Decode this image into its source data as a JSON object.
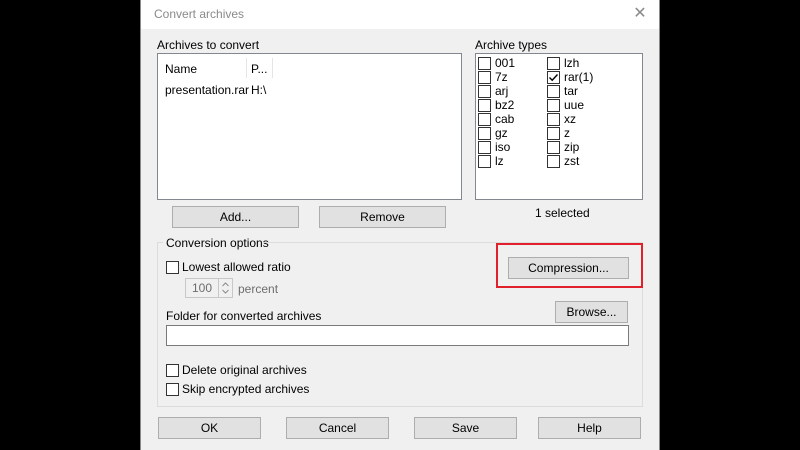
{
  "dialog": {
    "title": "Convert archives"
  },
  "archives": {
    "label": "Archives to convert",
    "columns": [
      "Name",
      "P..."
    ],
    "rows": [
      {
        "name": "presentation.rar",
        "path": "H:\\"
      }
    ]
  },
  "types": {
    "label": "Archive types",
    "col1": [
      {
        "name": "001",
        "checked": false
      },
      {
        "name": "7z",
        "checked": false
      },
      {
        "name": "arj",
        "checked": false
      },
      {
        "name": "bz2",
        "checked": false
      },
      {
        "name": "cab",
        "checked": false
      },
      {
        "name": "gz",
        "checked": false
      },
      {
        "name": "iso",
        "checked": false
      },
      {
        "name": "lz",
        "checked": false
      }
    ],
    "col2": [
      {
        "name": "lzh",
        "checked": false
      },
      {
        "name": "rar(1)",
        "checked": true
      },
      {
        "name": "tar",
        "checked": false
      },
      {
        "name": "uue",
        "checked": false
      },
      {
        "name": "xz",
        "checked": false
      },
      {
        "name": "z",
        "checked": false
      },
      {
        "name": "zip",
        "checked": false
      },
      {
        "name": "zst",
        "checked": false
      }
    ],
    "selected_text": "1 selected"
  },
  "buttons": {
    "add": "Add...",
    "remove": "Remove",
    "compression": "Compression...",
    "browse": "Browse...",
    "ok": "OK",
    "cancel": "Cancel",
    "save": "Save",
    "help": "Help"
  },
  "options": {
    "group_label": "Conversion options",
    "lowest_ratio": "Lowest allowed ratio",
    "ratio_value": "100",
    "percent": "percent",
    "folder_label": "Folder for converted archives",
    "folder_value": "",
    "delete_original": "Delete original archives",
    "skip_encrypted": "Skip encrypted archives"
  },
  "colors": {
    "highlight": "#e0202a",
    "background": "#000000"
  }
}
